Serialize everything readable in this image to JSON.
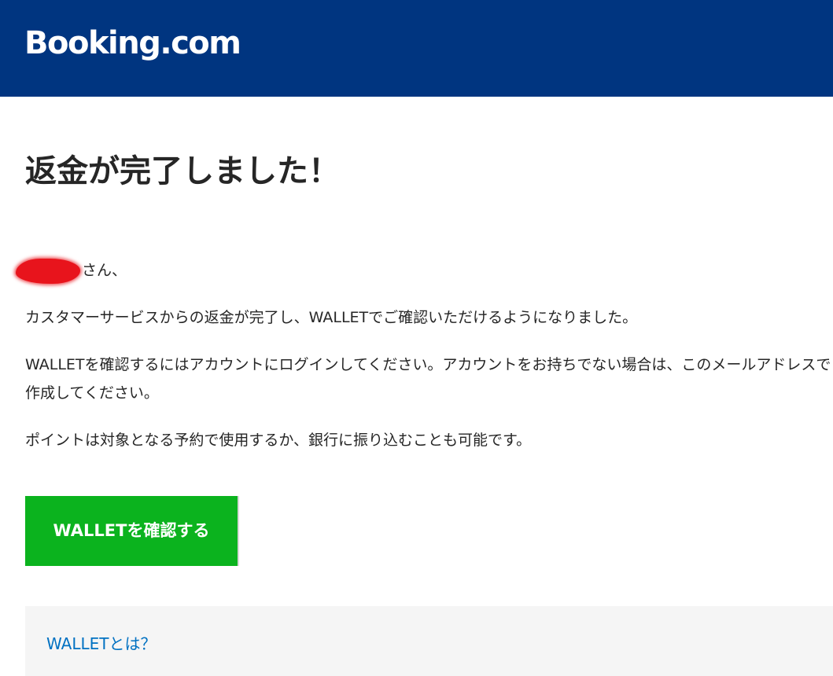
{
  "header": {
    "logo_text": "Booking.com",
    "background_color": "#003580"
  },
  "main": {
    "title": "返金が完了しました！",
    "greeting_suffix": "さん、",
    "paragraphs": [
      "カスタマーサービスからの返金が完了し、WALLETでご確認いただけるようになりました。",
      "WALLETを確認するにはアカウントにログインしてください。アカウントをお持ちでない場合は、このメールアドレスで作成してください。",
      "ポイントは対象となる予約で使用するか、銀行に振り込むことも可能です。"
    ],
    "cta_label": "WALLETを確認する",
    "cta_color": "#0bb31e"
  },
  "info": {
    "link_label": "WALLETとは？",
    "link_color": "#0071c2"
  }
}
